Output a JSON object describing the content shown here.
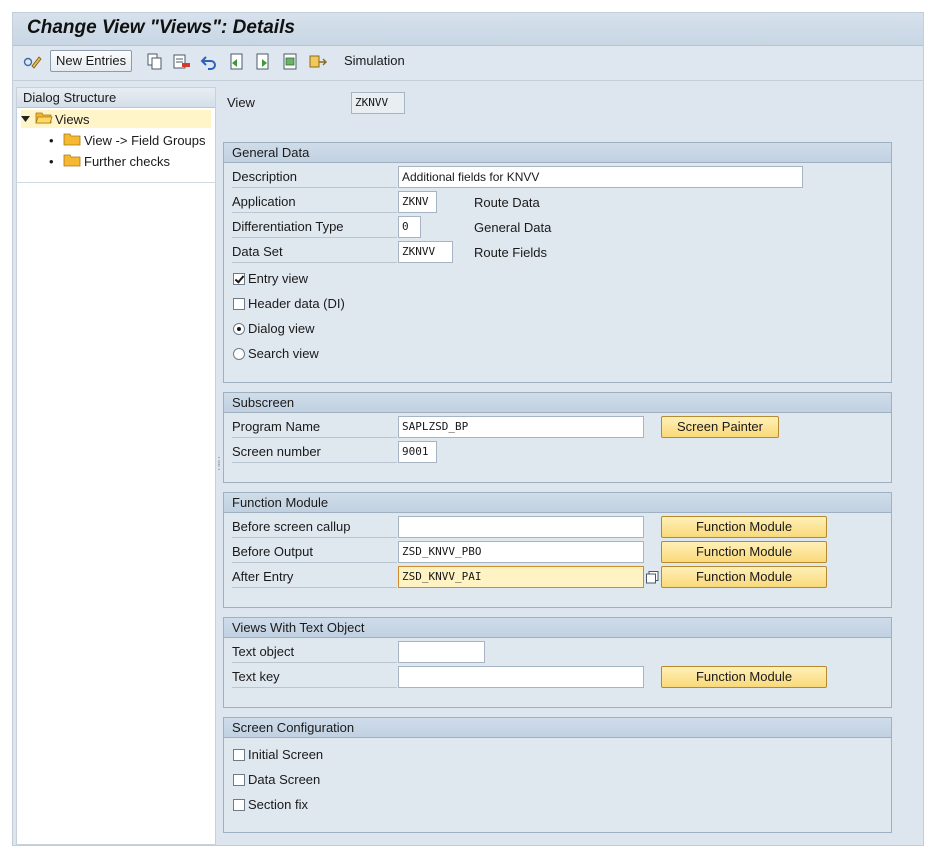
{
  "window": {
    "title": "Change View \"Views\": Details"
  },
  "toolbar": {
    "new_entries_label": "New Entries",
    "simulation_label": "Simulation"
  },
  "tree": {
    "header": "Dialog Structure",
    "root": "Views",
    "children": [
      "View -> Field Groups",
      "Further checks"
    ]
  },
  "view": {
    "label": "View",
    "value": "ZKNVV"
  },
  "general": {
    "title": "General Data",
    "description_label": "Description",
    "description_value": "Additional fields for KNVV",
    "application_label": "Application",
    "application_value": "ZKNV",
    "application_text": "Route Data",
    "diff_label": "Differentiation Type",
    "diff_value": "0",
    "diff_text": "General Data",
    "dataset_label": "Data Set",
    "dataset_value": "ZKNVV",
    "dataset_text": "Route Fields",
    "entry_view": "Entry view",
    "header_data": "Header data (DI)",
    "dialog_view": "Dialog view",
    "search_view": "Search view"
  },
  "subscreen": {
    "title": "Subscreen",
    "program_label": "Program Name",
    "program_value": "SAPLZSD_BP",
    "screen_painter": "Screen Painter",
    "screen_label": "Screen number",
    "screen_value": "9001"
  },
  "function": {
    "title": "Function Module",
    "before_callup_label": "Before screen callup",
    "before_callup_value": "",
    "before_output_label": "Before Output",
    "before_output_value": "ZSD_KNVV_PBO",
    "after_entry_label": "After Entry",
    "after_entry_value": "ZSD_KNVV_PAI",
    "button_label": "Function Module"
  },
  "textobj": {
    "title": "Views With Text Object",
    "text_object_label": "Text object",
    "text_object_value": "",
    "text_key_label": "Text key",
    "text_key_value": "",
    "button_label": "Function Module"
  },
  "screencfg": {
    "title": "Screen Configuration",
    "initial": "Initial Screen",
    "data": "Data Screen",
    "section": "Section fix"
  }
}
